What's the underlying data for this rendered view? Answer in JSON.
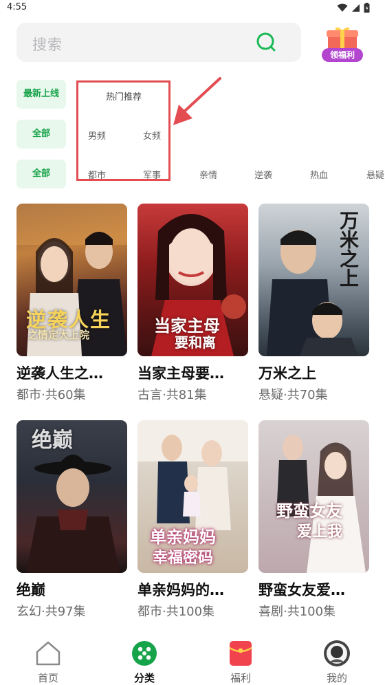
{
  "status": {
    "time": "4:55"
  },
  "search": {
    "placeholder": "搜索"
  },
  "welfare": {
    "label": "领福利"
  },
  "filters": {
    "row1_chip": "最新上线",
    "row2_chip": "全部",
    "row3_chip": "全部",
    "popular": "热门推荐",
    "gender": [
      "男频",
      "女频"
    ],
    "genres": [
      "都市",
      "军事",
      "亲情",
      "逆袭",
      "热血",
      "悬疑"
    ]
  },
  "cards": [
    {
      "title": "逆袭人生之…",
      "meta": "都市·共60集",
      "poster_text": "逆袭人生",
      "poster_sub": "之情定大上院"
    },
    {
      "title": "当家主母要…",
      "meta": "古言·共81集",
      "poster_text": "当家主母",
      "poster_sub": "要和离"
    },
    {
      "title": "万米之上",
      "meta": "悬疑·共70集",
      "poster_text": "万米之上",
      "poster_sub": ""
    },
    {
      "title": "绝巅",
      "meta": "玄幻·共97集",
      "poster_text": "绝巅",
      "poster_sub": ""
    },
    {
      "title": "单亲妈妈的…",
      "meta": "都市·共100集",
      "poster_text": "单亲妈妈",
      "poster_sub": "幸福密码"
    },
    {
      "title": "野蛮女友爱…",
      "meta": "喜剧·共100集",
      "poster_text": "野蛮女友",
      "poster_sub": "爱上我"
    }
  ],
  "nav": [
    {
      "label": "首页",
      "icon": "home-icon"
    },
    {
      "label": "分类",
      "icon": "category-icon"
    },
    {
      "label": "福利",
      "icon": "welfare-envelope-icon"
    },
    {
      "label": "我的",
      "icon": "profile-icon"
    }
  ],
  "colors": {
    "accent": "#17a34a",
    "chip_bg": "#e9f8ec",
    "highlight": "#e34d52"
  }
}
